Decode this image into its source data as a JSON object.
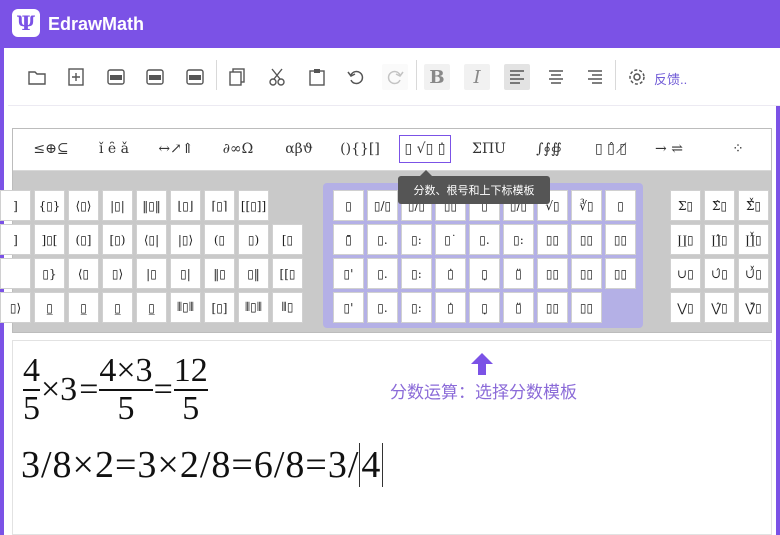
{
  "app": {
    "title": "EdrawMath",
    "logo_glyph": "Ψ",
    "accent": "#7b52e6"
  },
  "toolbar": {
    "buttons": [
      {
        "name": "open-icon"
      },
      {
        "name": "new-icon"
      },
      {
        "name": "export-png-icon",
        "label": "PNG"
      },
      {
        "name": "export-mml-icon",
        "label": "MML"
      },
      {
        "name": "export-tex-icon",
        "label": "TEX"
      },
      {
        "name": "copy-icon"
      },
      {
        "name": "cut-icon"
      },
      {
        "name": "paste-icon"
      },
      {
        "name": "undo-icon"
      },
      {
        "name": "redo-icon"
      },
      {
        "name": "bold-icon",
        "label": "B"
      },
      {
        "name": "italic-icon",
        "label": "I"
      },
      {
        "name": "align-left-icon"
      },
      {
        "name": "align-center-icon"
      },
      {
        "name": "align-right-icon"
      },
      {
        "name": "settings-icon"
      }
    ],
    "feedback_label": "反馈.."
  },
  "symbol_tabs": [
    {
      "label": "≤⊕⊆"
    },
    {
      "label": "ǐ ȇ ǎ"
    },
    {
      "label": "↔↗⇑"
    },
    {
      "label": "∂∞Ω"
    },
    {
      "label": "αβϑ"
    },
    {
      "label": "(){}[]"
    },
    {
      "label": "▯ √▯ ▯̇",
      "active": true
    },
    {
      "label": "ΣΠU"
    },
    {
      "label": "∫∮∯"
    },
    {
      "label": "▯ ▯̂ ▯̸"
    },
    {
      "label": "→ ⇌"
    },
    {
      "label": "⁘"
    }
  ],
  "tooltip": "分数、根号和上下标模板",
  "bracket_grid": [
    [
      "]",
      "{▯}",
      "⟨▯⟩",
      "|▯|",
      "‖▯‖",
      "⌊▯⌋",
      "⌈▯⌉",
      "[[▯]]"
    ],
    [
      "]",
      "]▯[",
      "(▯]",
      "[▯)",
      "⟨▯|",
      "|▯⟩",
      "(▯",
      "▯)",
      "[▯"
    ],
    [
      "",
      "▯}",
      "⟨▯",
      "▯⟩",
      "|▯",
      "▯|",
      "‖▯",
      "▯‖",
      "[[▯"
    ],
    [
      "▯⟩",
      "▯̲",
      "▯̲",
      "▯̲",
      "▯̲",
      "⦀▯⦀",
      "[▯]",
      "⦀▯⦀",
      "⦀▯"
    ]
  ],
  "fraction_grid": [
    [
      "▯",
      "▯/▯",
      "▯/▯",
      "▯▯",
      "▯",
      "▯/▯",
      "√▯",
      "∛▯",
      "▯"
    ],
    [
      "▯̄",
      "▯.",
      "▯:",
      "▯˙",
      "▯.",
      "▯:",
      "▯▯",
      "▯▯",
      "▯▯"
    ],
    [
      "▯'",
      "▯.",
      "▯:",
      "▯̇",
      "▯̣",
      "▯̈",
      "▯▯",
      "▯▯",
      "▯▯"
    ],
    [
      "▯'",
      "▯.",
      "▯:",
      "▯̇",
      "▯̣",
      "▯̈",
      "▯▯",
      "▯▯"
    ]
  ],
  "sum_grid": [
    [
      "Σ▯",
      "Σ̂▯",
      "Σ̂̌▯"
    ],
    [
      "∐▯",
      "∐̂▯",
      "∐̂̌▯"
    ],
    [
      "∪▯",
      "∪̂▯",
      "∪̂̌▯"
    ],
    [
      "⋁▯",
      "⋁̂▯",
      "⋁̂̌▯"
    ]
  ],
  "equation1": {
    "f1_num": "4",
    "f1_den": "5",
    "times1": "×3",
    "eq1": "=",
    "f2_num": "4×3",
    "f2_den": "5",
    "eq2": "=",
    "f3_num": "12",
    "f3_den": "5"
  },
  "equation2": {
    "text": "3/8×2=3×2/8=6/8=3/",
    "last": "4"
  },
  "annotation": "分数运算：选择分数模板"
}
